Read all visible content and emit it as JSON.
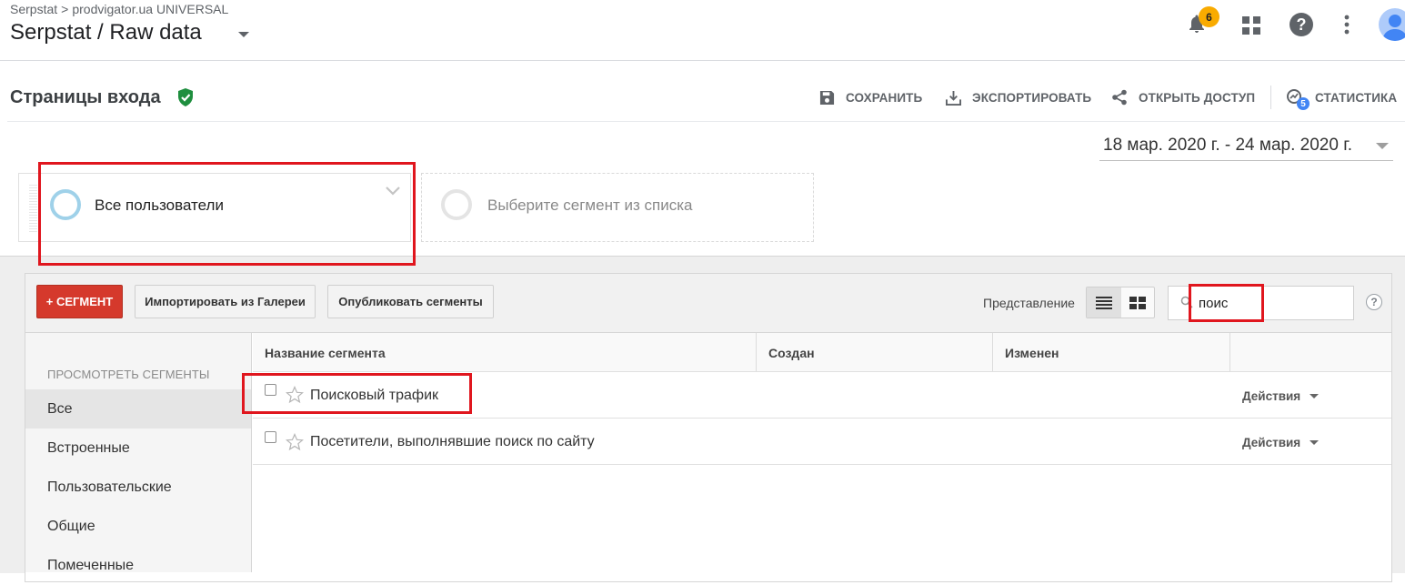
{
  "header": {
    "breadcrumb_account": "Serpstat",
    "breadcrumb_separator": ">",
    "breadcrumb_property": "prodvigator.ua UNIVERSAL",
    "view_title": "Serpstat / Raw data",
    "notification_count": "6"
  },
  "report": {
    "title": "Страницы входа",
    "actions": {
      "save": "СОХРАНИТЬ",
      "export": "ЭКСПОРТИРОВАТЬ",
      "share": "ОТКРЫТЬ ДОСТУП",
      "stats": "СТАТИСТИКА",
      "stats_badge": "5"
    },
    "date_range": "18 мар. 2020 г. - 24 мар. 2020 г."
  },
  "segments_bar": {
    "active_segment": "Все пользователи",
    "empty_slot": "Выберите сегмент из списка"
  },
  "picker": {
    "new_segment_button": "+ СЕГМЕНТ",
    "import_button": "Импортировать из Галереи",
    "publish_button": "Опубликовать сегменты",
    "view_label": "Представление",
    "search_value": "поис",
    "help": "?"
  },
  "nav": {
    "heading": "ПРОСМОТРЕТЬ СЕГМЕНТЫ",
    "items": [
      {
        "label": "Все",
        "active": true
      },
      {
        "label": "Встроенные"
      },
      {
        "label": "Пользовательские"
      },
      {
        "label": "Общие"
      },
      {
        "label": "Помеченные"
      }
    ]
  },
  "table": {
    "columns": [
      "Название сегмента",
      "Создан",
      "Изменен"
    ],
    "rows": [
      {
        "name": "Поисковый трафик",
        "actions": "Действия"
      },
      {
        "name": "Посетители, выполнявшие поиск по сайту",
        "actions": "Действия"
      }
    ]
  },
  "colors": {
    "highlight": "#e0161e",
    "primary_button": "#d5392c",
    "verified": "#1e8e3e",
    "notification": "#f9ab00"
  }
}
